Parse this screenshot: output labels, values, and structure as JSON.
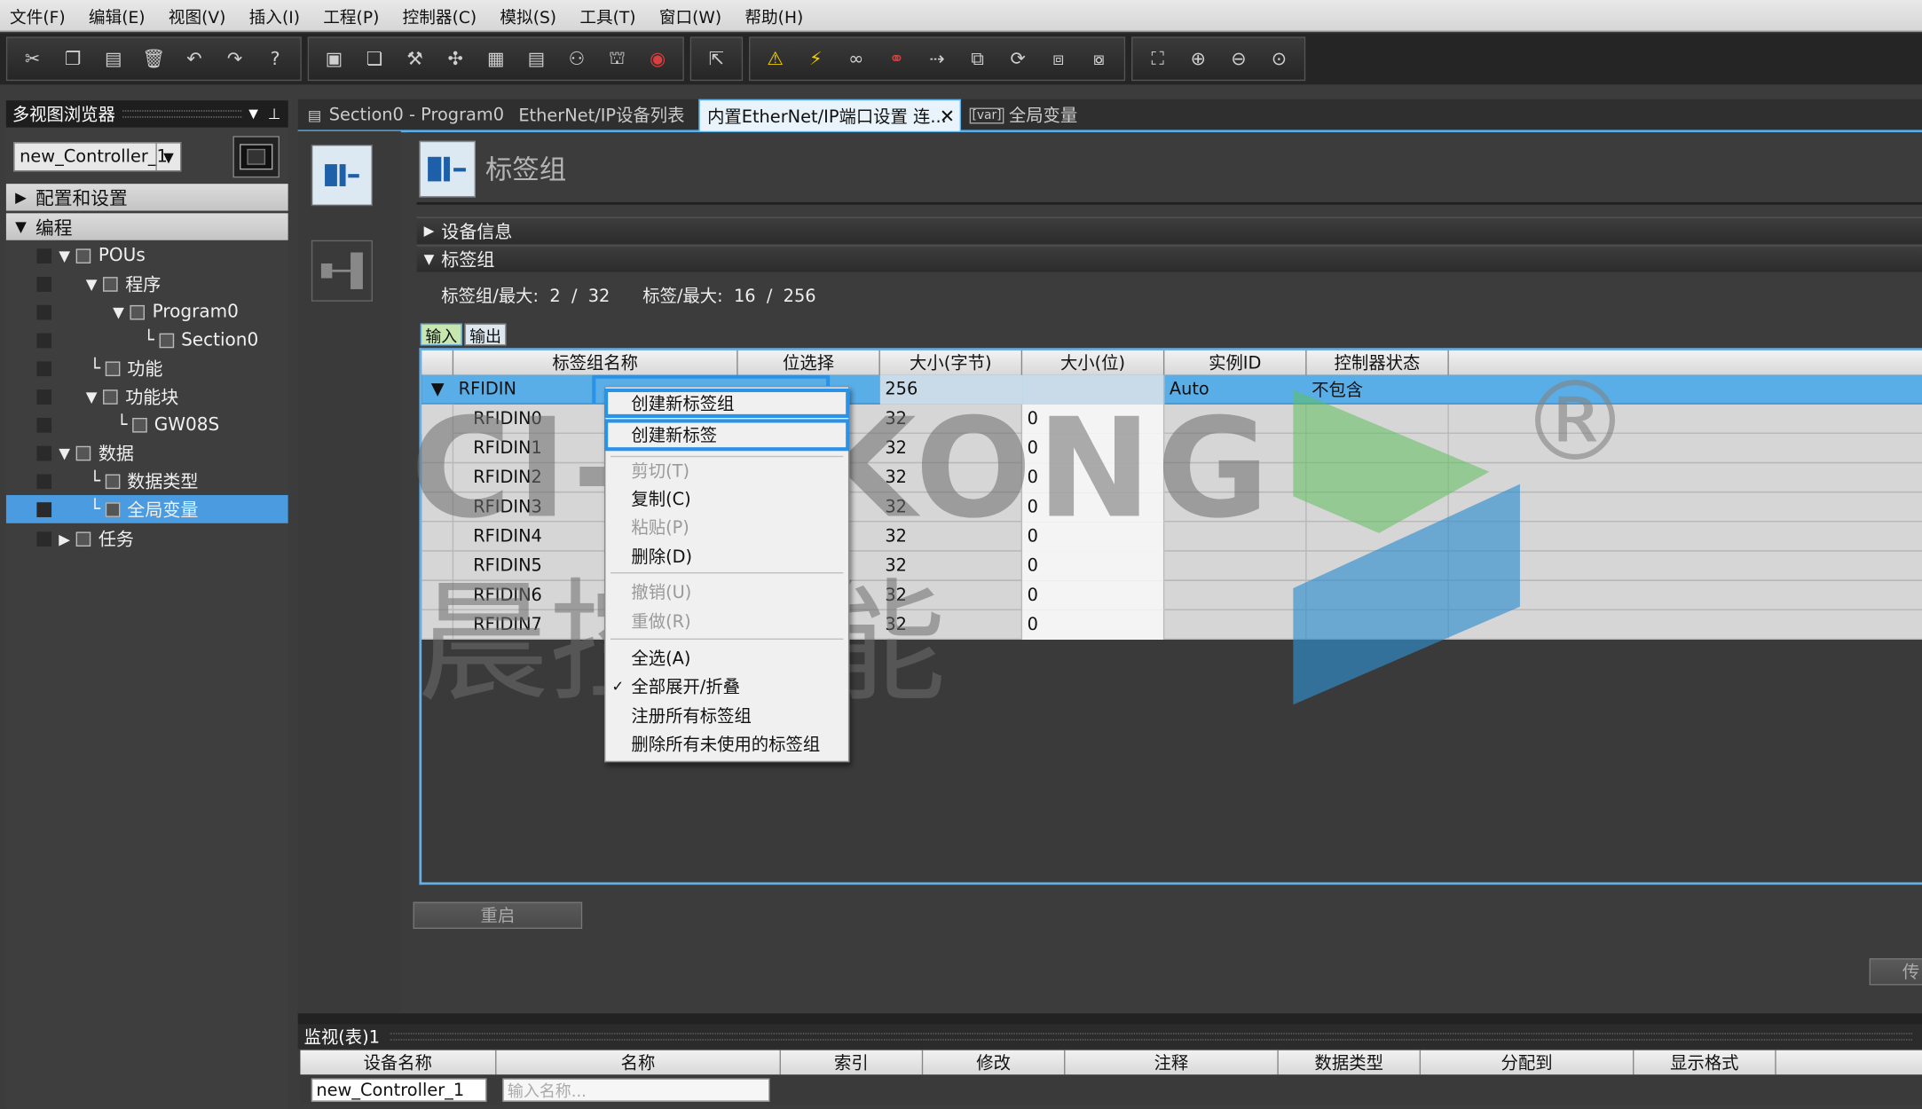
{
  "menu": [
    "文件(F)",
    "编辑(E)",
    "视图(V)",
    "插入(I)",
    "工程(P)",
    "控制器(C)",
    "模拟(S)",
    "工具(T)",
    "窗口(W)",
    "帮助(H)"
  ],
  "multiview": {
    "title": "多视图浏览器",
    "controller": "new_Controller_1"
  },
  "tree": {
    "config": "配置和设置",
    "programming": "编程",
    "pous": "POUs",
    "programs": "程序",
    "program0": "Program0",
    "section0": "Section0",
    "functions": "功能",
    "function_blocks": "功能块",
    "gw08s": "GW08S",
    "data": "数据",
    "data_types": "数据类型",
    "global_vars": "全局变量",
    "tasks": "任务"
  },
  "tabs": [
    "Section0 - Program0",
    "EtherNet/IP设备列表",
    "内置EtherNet/IP端口设置 连...",
    "全局变量"
  ],
  "tab_var_badge": "[var]",
  "page_title": "标签组",
  "sections": {
    "device_info": "设备信息",
    "tag_group": "标签组"
  },
  "counts": {
    "label1": "标签组/最大:",
    "val1": "2  /  32",
    "label2": "标签/最大:",
    "val2": "16  /  256"
  },
  "io_tabs": [
    "输入",
    "输出"
  ],
  "columns": [
    "标签组名称",
    "位选择",
    "大小(字节)",
    "大小(位)",
    "实例ID",
    "控制器状态"
  ],
  "group_row": {
    "name": "RFIDIN",
    "size_bytes": "256",
    "instance": "Auto",
    "status": "不包含"
  },
  "rows": [
    {
      "name": "RFIDIN0",
      "bytes": "32",
      "bits": "0"
    },
    {
      "name": "RFIDIN1",
      "bytes": "32",
      "bits": "0"
    },
    {
      "name": "RFIDIN2",
      "bytes": "32",
      "bits": "0"
    },
    {
      "name": "RFIDIN3",
      "bytes": "32",
      "bits": "0"
    },
    {
      "name": "RFIDIN4",
      "bytes": "32",
      "bits": "0"
    },
    {
      "name": "RFIDIN5",
      "bytes": "32",
      "bits": "0"
    },
    {
      "name": "RFIDIN6",
      "bytes": "32",
      "bits": "0"
    },
    {
      "name": "RFIDIN7",
      "bytes": "32",
      "bits": "0"
    }
  ],
  "context_menu": {
    "create_group": "创建新标签组",
    "create_tag": "创建新标签",
    "cut": "剪切(T)",
    "copy": "复制(C)",
    "paste": "粘贴(P)",
    "delete": "删除(D)",
    "undo": "撤销(U)",
    "redo": "重做(R)",
    "select_all": "全选(A)",
    "expand_all": "全部展开/折叠",
    "register_all": "注册所有标签组",
    "delete_unused": "删除所有未使用的标签组",
    "check_mark": "✓"
  },
  "buttons": {
    "restart": "重启",
    "transfer": "传"
  },
  "watch": {
    "title": "监视(表)1",
    "columns": [
      "设备名称",
      "名称",
      "索引",
      "修改",
      "注释",
      "数据类型",
      "分配到",
      "显示格式"
    ],
    "device": "new_Controller_1",
    "name_placeholder": "输入名称..."
  },
  "watermark": {
    "latin": "CI-INKONG",
    "cjk": "晨控智能",
    "reg": "®"
  },
  "colors": {
    "accent": "#4a9be0",
    "highlight": "#2a93e8",
    "logo_green": "#5fbf5f",
    "logo_blue": "#2f8fd0"
  }
}
